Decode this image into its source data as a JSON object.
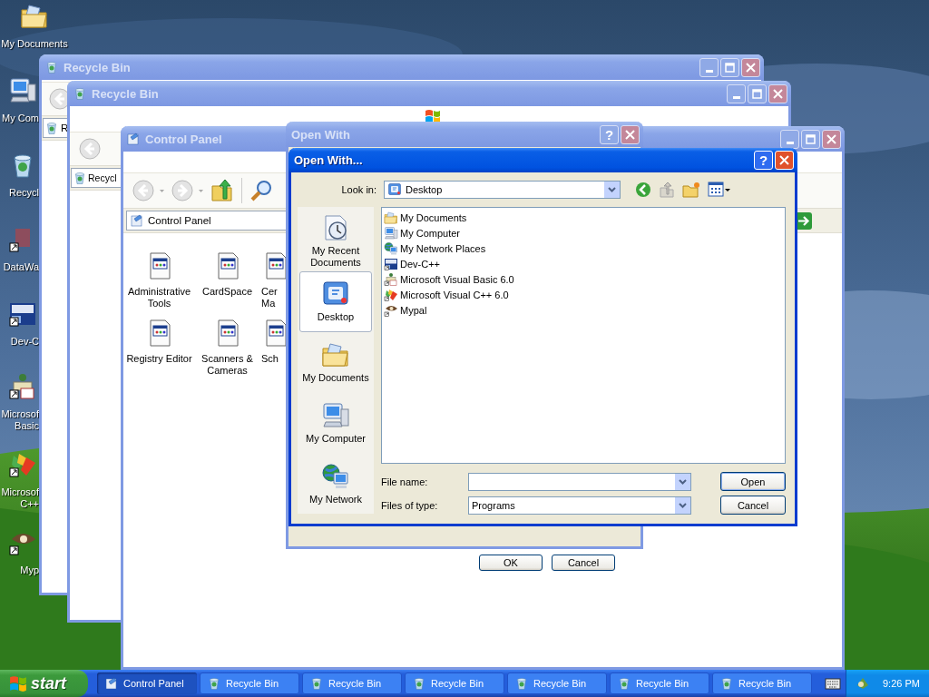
{
  "desktop_icons": [
    {
      "label": "My Documents"
    },
    {
      "label": "My Com"
    },
    {
      "label": "Recycl"
    },
    {
      "label": "DataWa"
    },
    {
      "label": "Dev-C"
    },
    {
      "label": "Microsof Basic"
    },
    {
      "label": "Microsof C++"
    },
    {
      "label": "Myp"
    }
  ],
  "windows": [
    {
      "kind": "explorer",
      "title": "Recycle Bin",
      "active": false,
      "address": "R"
    },
    {
      "kind": "explorer",
      "title": "Recycle Bin",
      "active": false,
      "address": "Recycl"
    },
    {
      "kind": "control_panel",
      "title": "Control Panel",
      "active": false,
      "address": "Control Panel",
      "items": [
        {
          "label": "Administrative Tools"
        },
        {
          "label": "CardSpace"
        },
        {
          "label": "Cer Ma"
        },
        {
          "label": "Registry Editor"
        },
        {
          "label": "Scanners & Cameras"
        },
        {
          "label": "Sch"
        }
      ]
    },
    {
      "kind": "dialog",
      "title": "Open With",
      "active": false,
      "help": "?",
      "buttons": [
        "OK",
        "Cancel"
      ]
    },
    {
      "kind": "file_dialog",
      "title": "Open With...",
      "active": true,
      "help": "?",
      "look_in_label": "Look in:",
      "look_in": "Desktop",
      "places": [
        {
          "label": "My Recent Documents",
          "selected": false
        },
        {
          "label": "Desktop",
          "selected": true
        },
        {
          "label": "My Documents",
          "selected": false
        },
        {
          "label": "My Computer",
          "selected": false
        },
        {
          "label": "My Network",
          "selected": false
        }
      ],
      "files": [
        {
          "name": "My Documents"
        },
        {
          "name": "My Computer"
        },
        {
          "name": "My Network Places"
        },
        {
          "name": "Dev-C++"
        },
        {
          "name": "Microsoft Visual Basic 6.0"
        },
        {
          "name": "Microsoft Visual C++ 6.0"
        },
        {
          "name": "Mypal"
        }
      ],
      "file_name_label": "File name:",
      "file_type_label": "Files of type:",
      "file_type": "Programs",
      "buttons": [
        "Open",
        "Cancel"
      ]
    }
  ],
  "taskbar": {
    "start": "start",
    "tasks": [
      {
        "label": "Control Panel",
        "selected": true
      },
      {
        "label": "Recycle Bin",
        "selected": false
      },
      {
        "label": "Recycle Bin",
        "selected": false
      },
      {
        "label": "Recycle Bin",
        "selected": false
      },
      {
        "label": "Recycle Bin",
        "selected": false
      },
      {
        "label": "Recycle Bin",
        "selected": false
      },
      {
        "label": "Recycle Bin",
        "selected": false
      }
    ],
    "clock": "9:26 PM"
  }
}
